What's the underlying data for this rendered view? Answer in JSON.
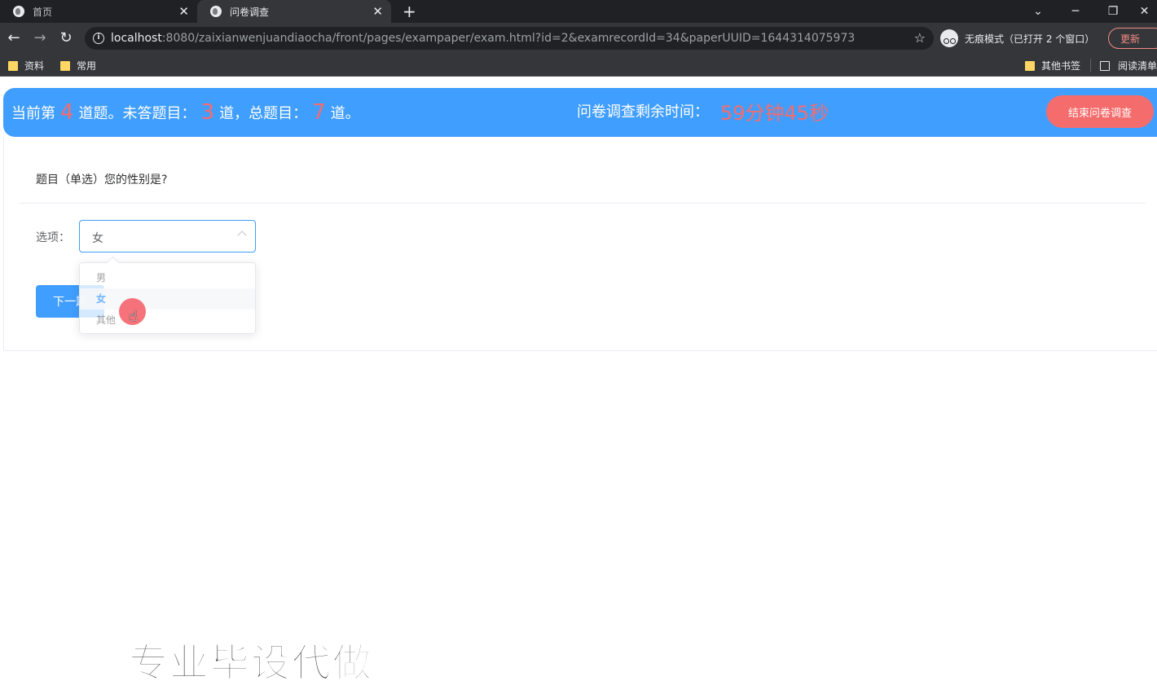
{
  "browser": {
    "tabs": [
      {
        "label": "首页",
        "close": "✕"
      },
      {
        "label": "问卷调查",
        "close": "✕"
      }
    ],
    "new_tab": "+",
    "url_host": "localhost",
    "url_rest": ":8080/zaixianwenjuandiaocha/front/pages/exampaper/exam.html?id=2&examrecordId=34&paperUUID=1644314075973",
    "incognito_label": "无痕模式（已打开 2 个窗口）",
    "update_label": "更新",
    "bookmarks": [
      {
        "label": "资料",
        "icon": "folder-icon"
      },
      {
        "label": "常用",
        "icon": "folder-icon"
      },
      {
        "label": "其他书签",
        "icon": "folder-icon"
      },
      {
        "label": "阅读清单",
        "icon": "list-icon"
      }
    ]
  },
  "banner": {
    "current_prefix": "当前第",
    "current_num": "4",
    "current_mid": "道题。未答题目：",
    "unanswered_num": "3",
    "unanswered_mid": "道，总题目：",
    "total_num": "7",
    "total_suffix": "道。",
    "timer_label": "问卷调查剩余时间：",
    "timer_value": "59分钟45秒",
    "end_button": "结束问卷调查"
  },
  "question": {
    "title": "题目（单选）您的性别是?",
    "option_label": "选项：",
    "selected_value": "女",
    "options": [
      "男",
      "女",
      "其他"
    ],
    "next_button": "下一题"
  },
  "watermark": "专业毕设代做",
  "colors": {
    "primary": "#409eff",
    "danger": "#f56c6c"
  }
}
